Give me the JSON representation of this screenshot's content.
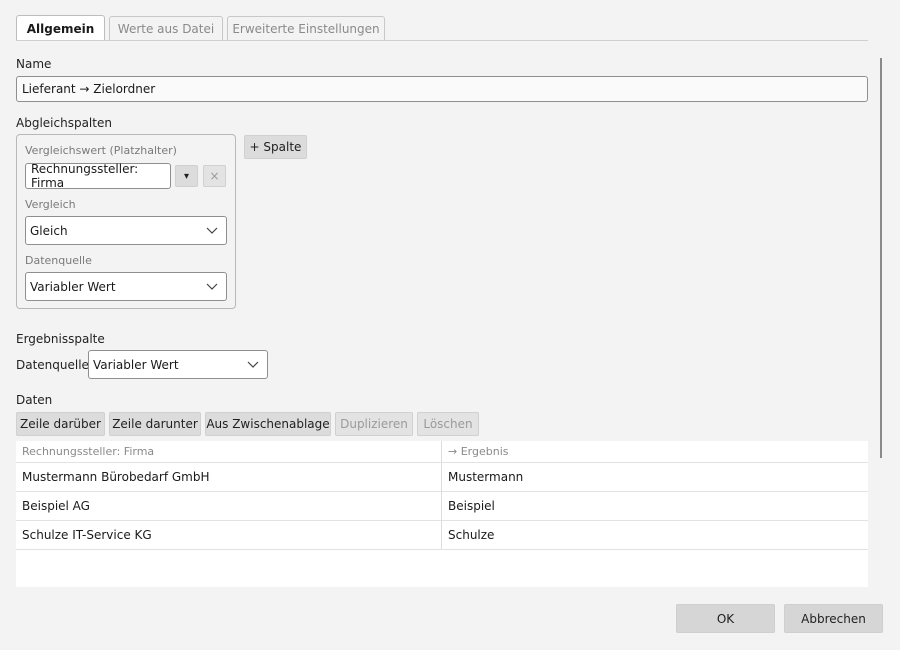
{
  "tabs": [
    {
      "label": "Allgemein"
    },
    {
      "label": "Werte aus Datei"
    },
    {
      "label": "Erweiterte Einstellungen"
    }
  ],
  "name": {
    "label": "Name",
    "value": "Lieferant → Zielordner"
  },
  "abgleich": {
    "label": "Abgleichspalten",
    "add_column_label": "+ Spalte",
    "compare_value_label": "Vergleichswert (Platzhalter)",
    "compare_value": "Rechnungssteller: Firma",
    "compare_label": "Vergleich",
    "compare_value_select": "Gleich",
    "source_label": "Datenquelle",
    "source_value": "Variabler Wert",
    "dropdown_button": "▾",
    "remove_button": "×"
  },
  "ergebnis": {
    "label": "Ergebnisspalte",
    "source_label": "Datenquelle",
    "source_value": "Variabler Wert"
  },
  "daten": {
    "label": "Daten",
    "buttons": {
      "insert_above": "Zeile darüber",
      "insert_below": "Zeile darunter",
      "from_clipboard": "Aus Zwischenablage",
      "duplicate": "Duplizieren",
      "delete": "Löschen"
    },
    "columns": [
      "Rechnungssteller: Firma",
      "→ Ergebnis"
    ],
    "rows": [
      [
        "Mustermann Bürobedarf GmbH",
        "Mustermann"
      ],
      [
        "Beispiel AG",
        "Beispiel"
      ],
      [
        "Schulze IT-Service KG",
        "Schulze"
      ]
    ]
  },
  "footer": {
    "ok": "OK",
    "cancel": "Abbrechen"
  }
}
